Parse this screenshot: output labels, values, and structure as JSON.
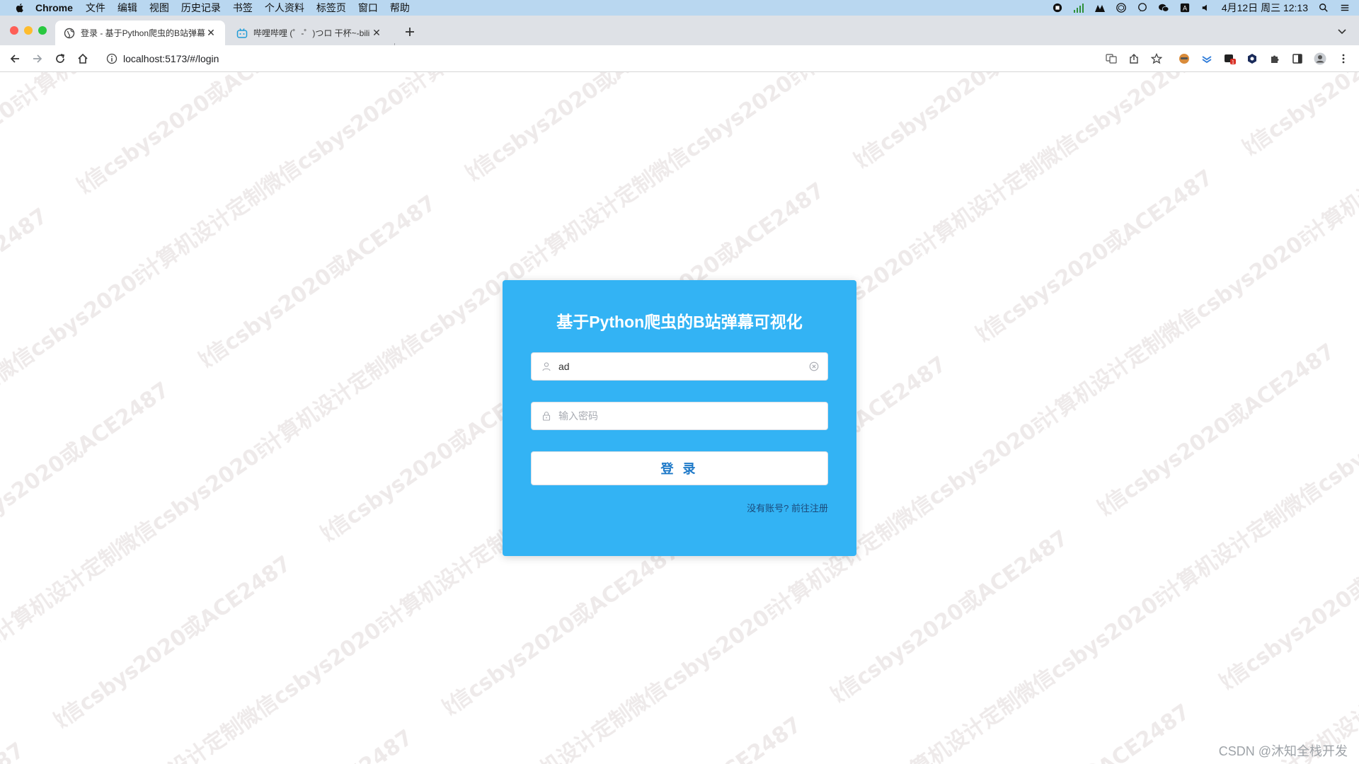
{
  "menubar": {
    "app": "Chrome",
    "items": [
      "文件",
      "编辑",
      "视图",
      "历史记录",
      "书签",
      "个人资料",
      "标签页",
      "窗口",
      "帮助"
    ],
    "clock": "4月12日 周三  12:13"
  },
  "tabs": [
    {
      "title": "登录 - 基于Python爬虫的B站弹幕",
      "active": true
    },
    {
      "title": "哔哩哔哩 (゜-゜)つロ 干杯~-bili",
      "active": false
    }
  ],
  "toolbar": {
    "url": "localhost:5173/#/login"
  },
  "login": {
    "title": "基于Python爬虫的B站弹幕可视化",
    "username_value": "ad",
    "password_placeholder": "输入密码",
    "submit_label": "登 录",
    "register_link": "没有账号? 前往注册"
  },
  "watermark": "计算机设计定制微信csbys2020或ACE2487",
  "footer_credit": "CSDN @沐知全栈开发",
  "colors": {
    "card": "#33b3f4",
    "button_text": "#1e79c8",
    "menubar": "#b9d7f0",
    "tabstrip": "#dee1e6"
  }
}
